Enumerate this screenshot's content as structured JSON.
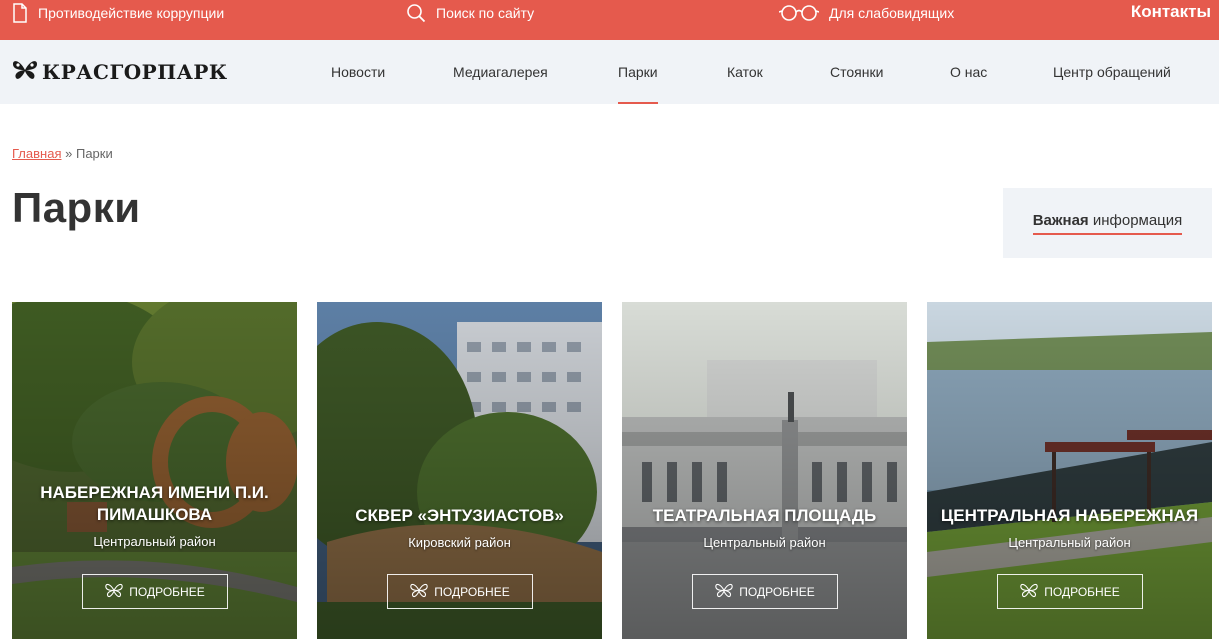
{
  "topbar": {
    "anticorruption": "Противодействие коррупции",
    "search": "Поиск по сайту",
    "low_vision": "Для слабовидящих",
    "contacts": "Контакты"
  },
  "logo": {
    "text": "КРАСГОРПАРК"
  },
  "nav": [
    {
      "label": "Новости"
    },
    {
      "label": "Медиагалерея"
    },
    {
      "label": "Парки"
    },
    {
      "label": "Каток"
    },
    {
      "label": "Стоянки"
    },
    {
      "label": "О нас"
    },
    {
      "label": "Центр обращений"
    }
  ],
  "breadcrumb": {
    "home": "Главная",
    "separator": "»",
    "current": "Парки"
  },
  "page": {
    "title": "Парки"
  },
  "info": {
    "bold": "Важная",
    "rest": "информация"
  },
  "cards": [
    {
      "name": "Набережная имени П.И. Пимашкова",
      "district": "Центральный район",
      "button": "ПОДРОБНЕЕ"
    },
    {
      "name": "Сквер «Энтузиастов»",
      "district": "Кировский район",
      "button": "ПОДРОБНЕЕ"
    },
    {
      "name": "Театральная площадь",
      "district": "Центральный район",
      "button": "ПОДРОБНЕЕ"
    },
    {
      "name": "Центральная набережная",
      "district": "Центральный район",
      "button": "ПОДРОБНЕЕ"
    }
  ],
  "colors": {
    "accent": "#e55a4d",
    "nav_bg": "#f0f3f7"
  }
}
